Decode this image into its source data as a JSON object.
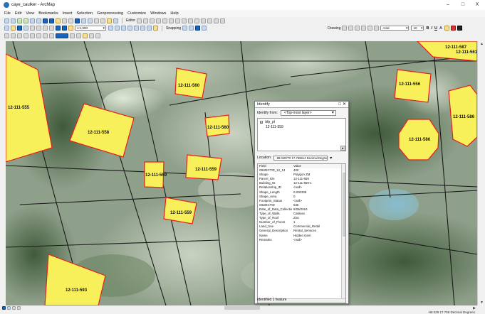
{
  "window": {
    "title": "caye_caulker - ArcMap",
    "controls": [
      "–",
      "□",
      "X"
    ]
  },
  "menu": [
    "File",
    "Edit",
    "View",
    "Bookmarks",
    "Insert",
    "Selection",
    "Geoprocessing",
    "Customize",
    "Windows",
    "Help"
  ],
  "toolbar": {
    "scale": "1:1,000",
    "editor_label": "Editor",
    "snapping_label": "Snapping",
    "drawing_label": "Drawing",
    "font_name": "Arial",
    "font_size": "10",
    "bold": "B",
    "italic": "I",
    "underline": "U",
    "text_color_label": "A"
  },
  "map": {
    "parcels": [
      {
        "label": "12-111-555"
      },
      {
        "label": "12-111-558"
      },
      {
        "label": "12-111-560"
      },
      {
        "label": "12-111-560"
      },
      {
        "label": "12-111-559"
      },
      {
        "label": "12-111-559"
      },
      {
        "label": "12-111-559"
      },
      {
        "label": "12-111-556"
      },
      {
        "label": "12-111-586"
      },
      {
        "label": "12-111-593"
      },
      {
        "label": "12-111-587"
      },
      {
        "label": "12-111-586"
      },
      {
        "label": "12-111-561"
      }
    ]
  },
  "identify": {
    "title": "Identify",
    "from_label": "Identify from:",
    "from_value": "<Top-most layer>",
    "tree_layer": "bfp_pl",
    "tree_feature": "12-111-559",
    "location_label": "Location:",
    "location_value": "-88.028770 17.758614 Decimal Degrees",
    "header_field": "Field",
    "header_value": "Value",
    "rows": [
      {
        "field": "OBJECTID_12_13",
        "value": "400"
      },
      {
        "field": "Shape",
        "value": "Polygon ZM"
      },
      {
        "field": "Parcel_IDs",
        "value": "12-111-559"
      },
      {
        "field": "Building_ID",
        "value": "12-111-559-1"
      },
      {
        "field": "Relationship_ID",
        "value": "<null>"
      },
      {
        "field": "Shape_Length",
        "value": "0.000338"
      },
      {
        "field": "Shape_Area",
        "value": "0"
      },
      {
        "field": "Footprint_Status",
        "value": "<null>"
      },
      {
        "field": "OBJECTID",
        "value": "535"
      },
      {
        "field": "Date_of_Data_Collection",
        "value": "8/28/2016"
      },
      {
        "field": "Type_of_Walls",
        "value": "Cabinex"
      },
      {
        "field": "Type_of_Roof",
        "value": "Zinc"
      },
      {
        "field": "Number_of_Floors",
        "value": "1"
      },
      {
        "field": "Land_Use",
        "value": "Commercial_Retail"
      },
      {
        "field": "General_Description",
        "value": "Rental_Services"
      },
      {
        "field": "Name",
        "value": "Hidden Gem"
      },
      {
        "field": "Remarks",
        "value": "<null>"
      }
    ],
    "footer": "Identified 1 feature"
  },
  "status": {
    "coords": "-88.029 17.758 Decimal Degrees"
  },
  "colors": {
    "parcel_fill": "#f7f05a",
    "parcel_outline": "#e81d1d",
    "lot_line": "#1a1a1a"
  }
}
